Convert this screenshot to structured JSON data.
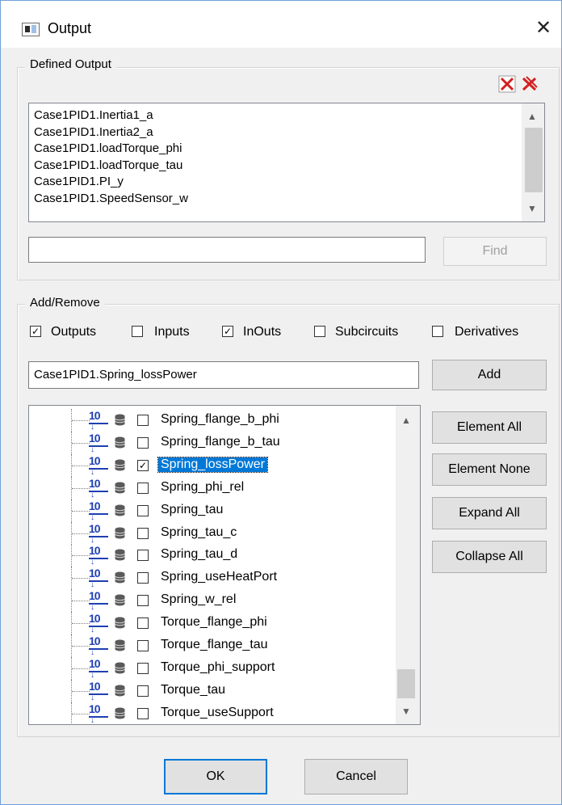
{
  "window": {
    "title": "Output",
    "close_glyph": "✕"
  },
  "defined_output": {
    "legend": "Defined Output",
    "list": [
      "Case1PID1.Inertia1_a",
      "Case1PID1.Inertia2_a",
      "Case1PID1.loadTorque_phi",
      "Case1PID1.loadTorque_tau",
      "Case1PID1.PI_y",
      "Case1PID1.SpeedSensor_w"
    ],
    "find_value": "",
    "find_label": "Find",
    "delete_icon": "delete-selected-icon",
    "delete_all_icon": "delete-all-icon",
    "delete_color": "#d32020"
  },
  "add_remove": {
    "legend": "Add/Remove",
    "filters": [
      {
        "label": "Outputs",
        "checked": true
      },
      {
        "label": "Inputs",
        "checked": false
      },
      {
        "label": "InOuts",
        "checked": true
      },
      {
        "label": "Subcircuits",
        "checked": false
      },
      {
        "label": "Derivatives",
        "checked": false
      }
    ],
    "add_value": "Case1PID1.Spring_lossPower",
    "add_label": "Add",
    "tree_icon": "io-variable-icon",
    "tree_icon_text": "10",
    "tree_items": [
      {
        "label": "Spring_flange_b_phi",
        "checked": false,
        "selected": false
      },
      {
        "label": "Spring_flange_b_tau",
        "checked": false,
        "selected": false
      },
      {
        "label": "Spring_lossPower",
        "checked": true,
        "selected": true
      },
      {
        "label": "Spring_phi_rel",
        "checked": false,
        "selected": false
      },
      {
        "label": "Spring_tau",
        "checked": false,
        "selected": false
      },
      {
        "label": "Spring_tau_c",
        "checked": false,
        "selected": false
      },
      {
        "label": "Spring_tau_d",
        "checked": false,
        "selected": false
      },
      {
        "label": "Spring_useHeatPort",
        "checked": false,
        "selected": false
      },
      {
        "label": "Spring_w_rel",
        "checked": false,
        "selected": false
      },
      {
        "label": "Torque_flange_phi",
        "checked": false,
        "selected": false
      },
      {
        "label": "Torque_flange_tau",
        "checked": false,
        "selected": false
      },
      {
        "label": "Torque_phi_support",
        "checked": false,
        "selected": false
      },
      {
        "label": "Torque_tau",
        "checked": false,
        "selected": false
      },
      {
        "label": "Torque_useSupport",
        "checked": false,
        "selected": false
      }
    ],
    "buttons": {
      "element_all": "Element All",
      "element_none": "Element None",
      "expand_all": "Expand All",
      "collapse_all": "Collapse All"
    }
  },
  "footer": {
    "ok": "OK",
    "cancel": "Cancel"
  },
  "colors": {
    "selection": "#0078d7",
    "io_icon": "#1f3fb3",
    "window_border": "#6f9fd8"
  }
}
